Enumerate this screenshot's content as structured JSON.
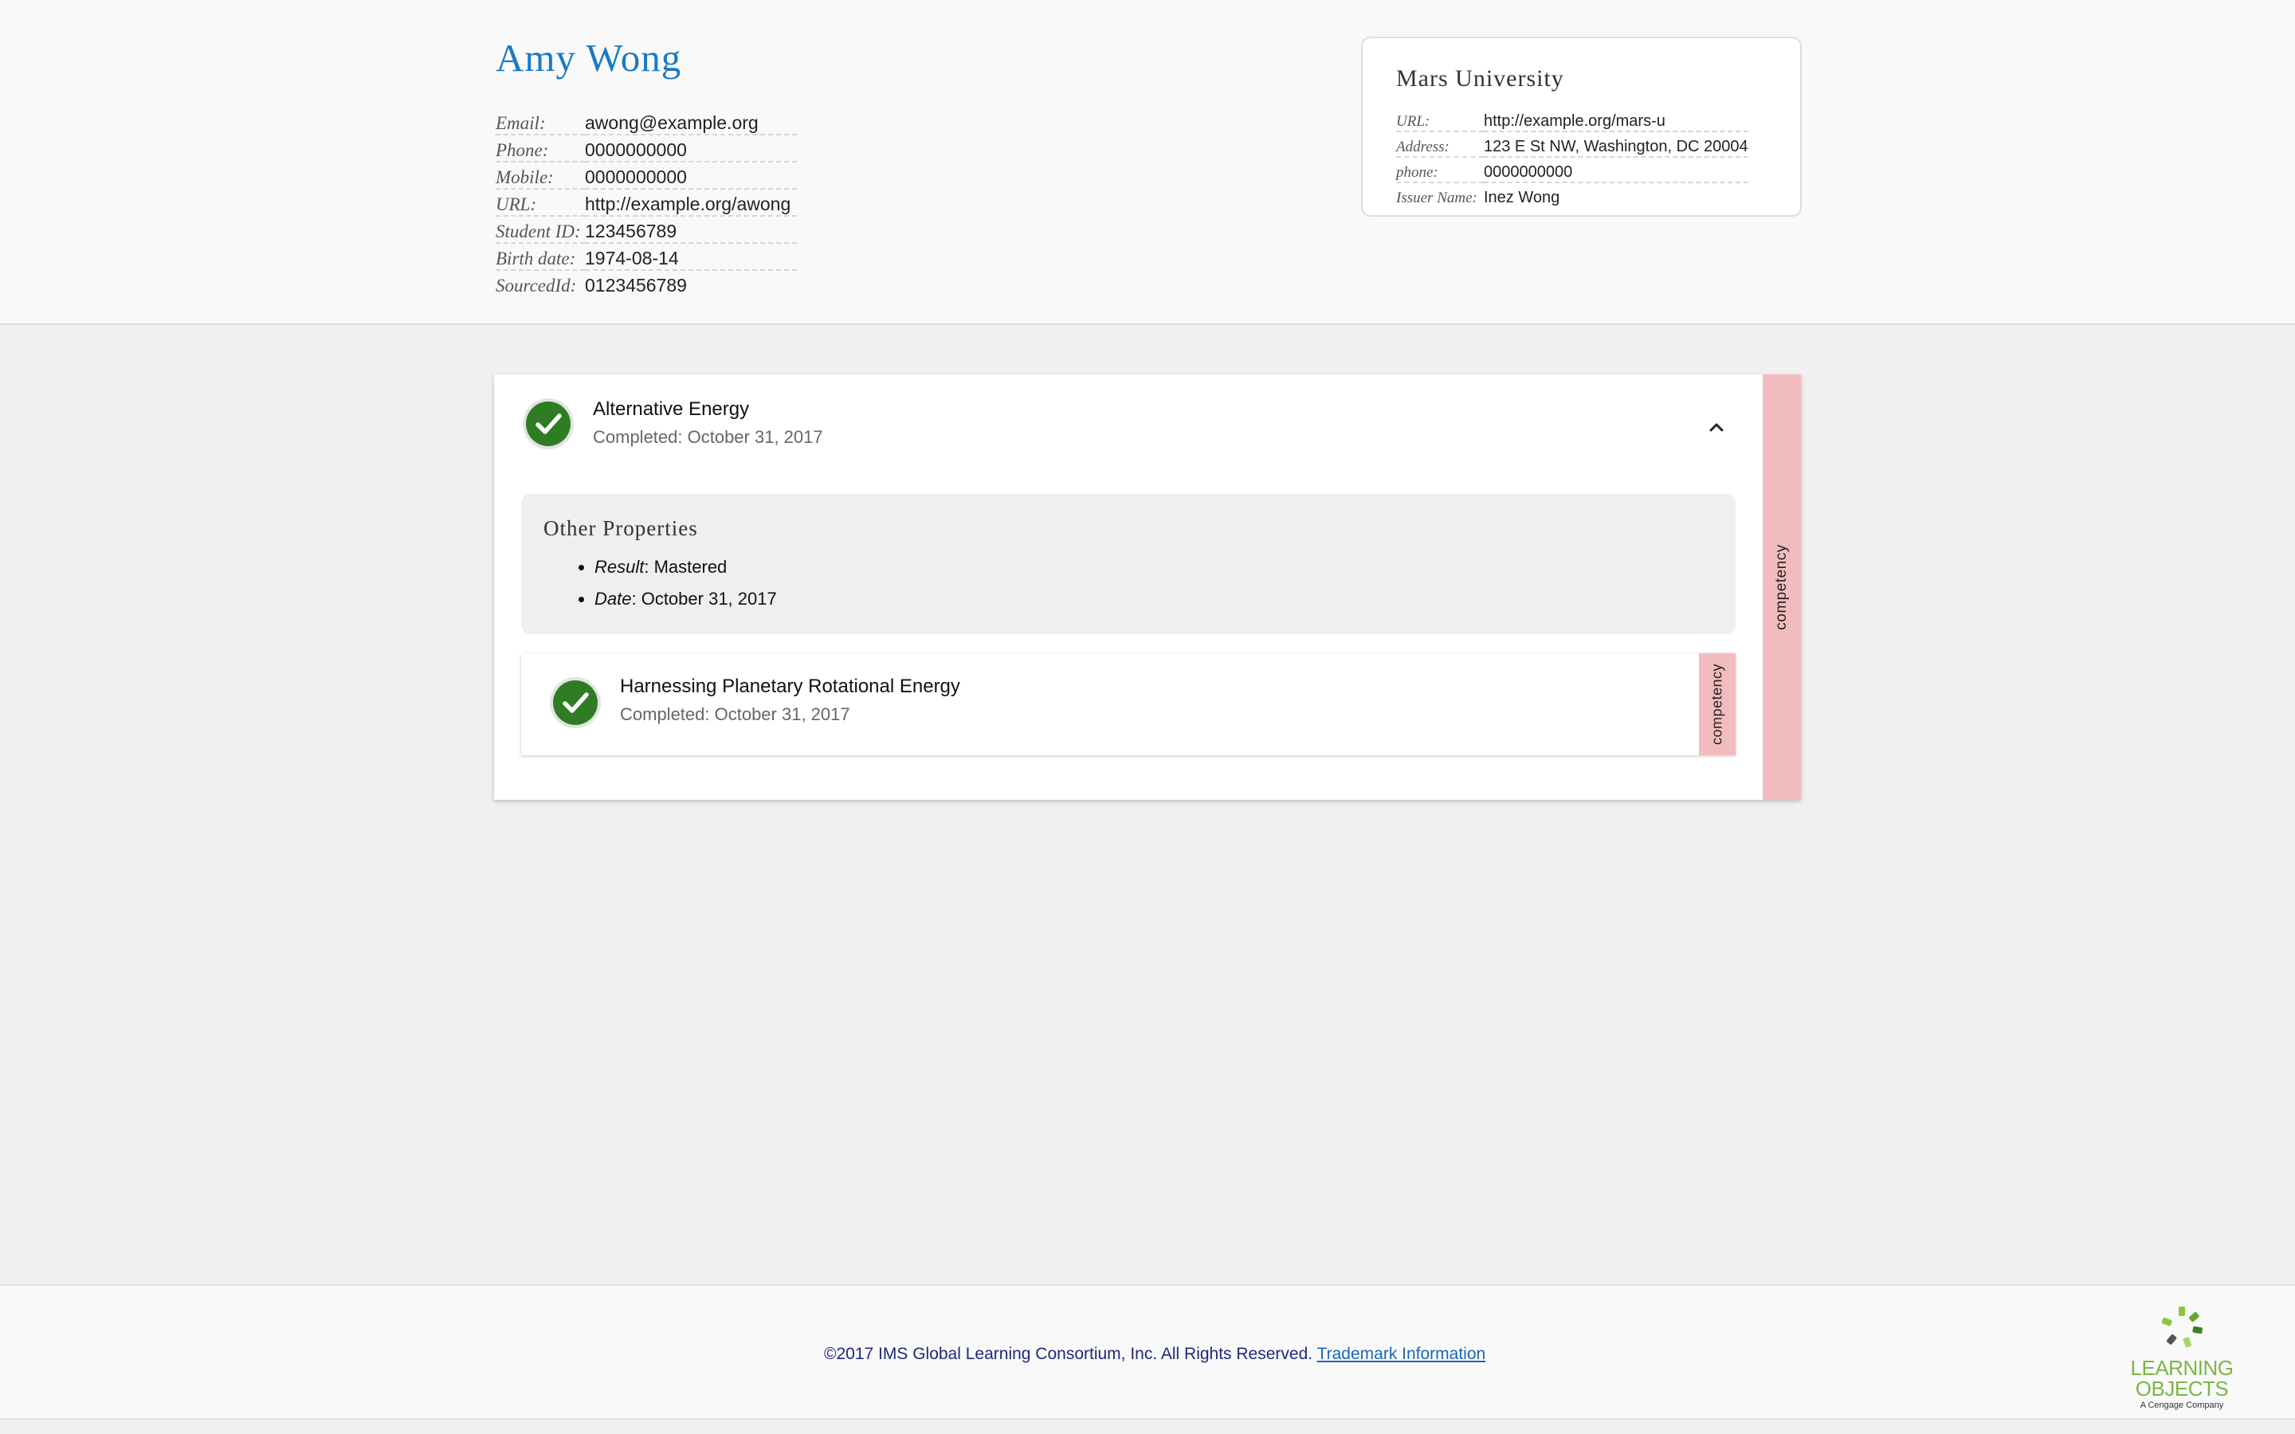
{
  "person": {
    "name": "Amy Wong",
    "fields": [
      {
        "label": "Email:",
        "value": "awong@example.org"
      },
      {
        "label": "Phone:",
        "value": "0000000000"
      },
      {
        "label": "Mobile:",
        "value": "0000000000"
      },
      {
        "label": "URL:",
        "value": "http://example.org/awong"
      },
      {
        "label": "Student ID:",
        "value": "123456789"
      },
      {
        "label": "Birth date:",
        "value": "1974-08-14"
      },
      {
        "label": "SourcedId:",
        "value": "0123456789"
      }
    ]
  },
  "issuer": {
    "name": "Mars University",
    "fields": [
      {
        "label": "URL:",
        "value": "http://example.org/mars-u"
      },
      {
        "label": "Address:",
        "value": "123 E St NW, Washington, DC 20004"
      },
      {
        "label": "phone:",
        "value": "0000000000"
      },
      {
        "label": "Issuer Name:",
        "value": "Inez Wong"
      }
    ]
  },
  "achievement": {
    "title": "Alternative Energy",
    "completed": "Completed: October 31, 2017",
    "type_label": "competency",
    "other_properties": {
      "heading": "Other Properties",
      "items": [
        {
          "key": "Result",
          "value": ": Mastered"
        },
        {
          "key": "Date",
          "value": ": October 31, 2017"
        }
      ]
    },
    "child": {
      "title": "Harnessing Planetary Rotational Energy",
      "completed": "Completed: October 31, 2017",
      "type_label": "competency"
    }
  },
  "footer": {
    "copyright": "©2017 IMS Global Learning Consortium, Inc. All Rights Reserved.",
    "trademark_link": "Trademark Information",
    "logo": {
      "line1": "LEARNING",
      "line2": "OBJECTS",
      "line3": "A Cengage Company"
    }
  },
  "colors": {
    "name": "#1a7ac4",
    "check": "#2f7d23",
    "strip": "#f2bcbe",
    "logo": "#7ab648"
  },
  "icons": {
    "status": "check-circle-icon",
    "collapse": "chevron-up-icon"
  }
}
